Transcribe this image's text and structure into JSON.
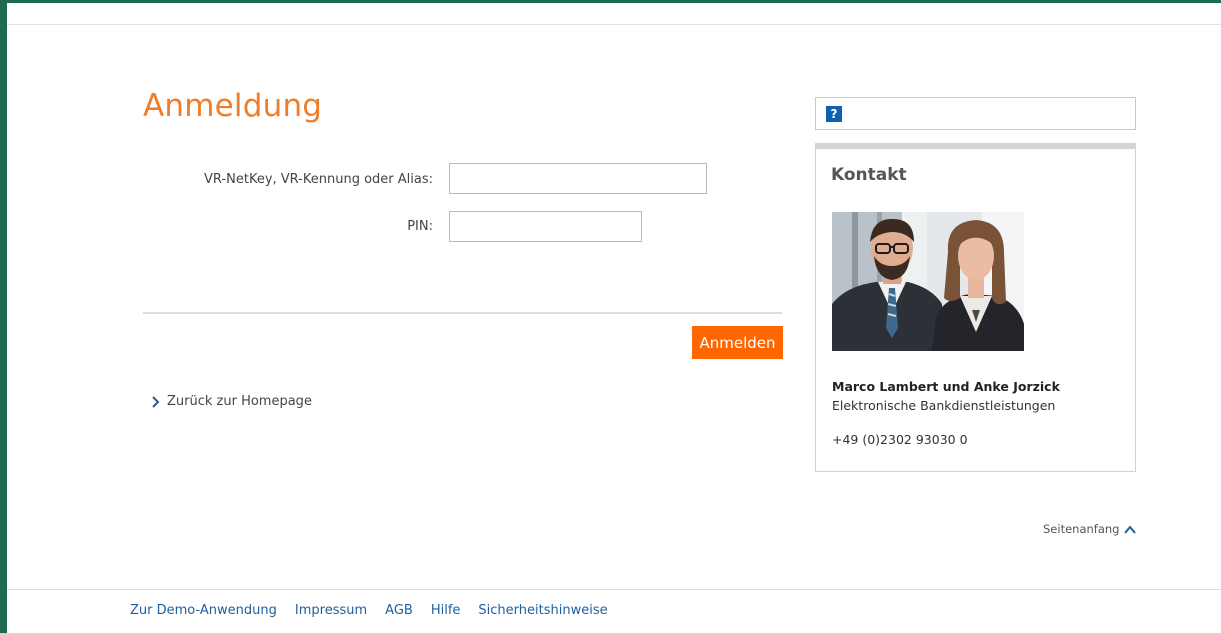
{
  "page": {
    "title": "Anmeldung"
  },
  "form": {
    "netkey_label": "VR-NetKey, VR-Kennung oder Alias:",
    "netkey_value": "",
    "pin_label": "PIN:",
    "pin_value": "",
    "submit_label": "Anmelden"
  },
  "back_link": {
    "label": "Zurück zur Homepage",
    "icon": "chevron-right-icon"
  },
  "help": {
    "icon_glyph": "?",
    "icon": "help-icon"
  },
  "contact": {
    "title": "Kontakt",
    "name": "Marco Lambert und Anke Jorzick",
    "role": "Elektronische Bankdienstleistungen",
    "phone": "+49 (0)2302 93030 0"
  },
  "to_top": {
    "label": "Seitenanfang",
    "icon": "chevron-up-icon"
  },
  "footer": {
    "links": [
      "Zur Demo-Anwendung",
      "Impressum",
      "AGB",
      "Hilfe",
      "Sicherheitshinweise"
    ]
  },
  "colors": {
    "accent": "#f07d2b",
    "button": "#ff6600",
    "frame": "#1e6b50",
    "link": "#1f5f9e",
    "help_icon": "#0a62b0"
  }
}
